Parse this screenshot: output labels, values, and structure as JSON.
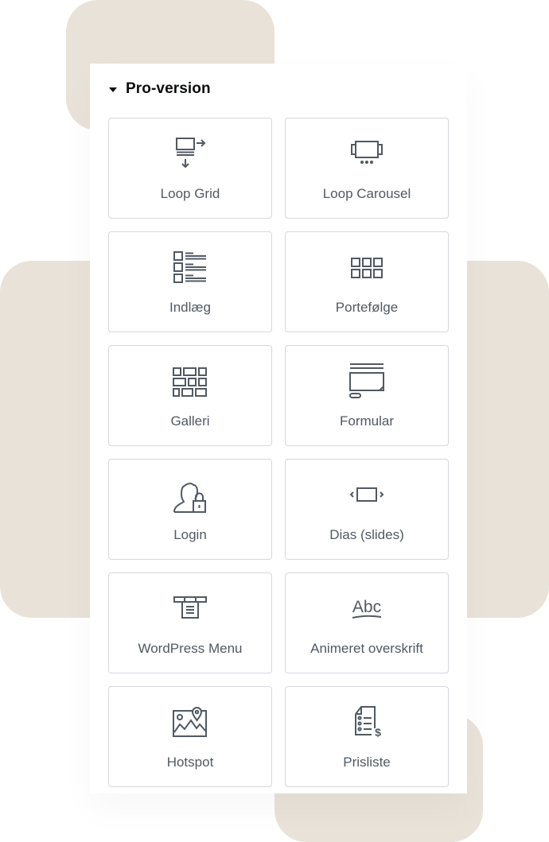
{
  "colors": {
    "background_shape": "#e8e2d8",
    "panel": "#ffffff",
    "tile_border": "#d5d8dc",
    "icon": "#515962",
    "label": "#515962",
    "heading": "#0c0d0e"
  },
  "section": {
    "title": "Pro-version",
    "expanded": true,
    "caret_icon": "caret-down-icon"
  },
  "widgets": [
    {
      "label": "Loop Grid",
      "icon": "loop-grid-icon"
    },
    {
      "label": "Loop Carousel",
      "icon": "loop-carousel-icon"
    },
    {
      "label": "Indlæg",
      "icon": "posts-icon"
    },
    {
      "label": "Portefølge",
      "icon": "portfolio-icon"
    },
    {
      "label": "Galleri",
      "icon": "gallery-icon"
    },
    {
      "label": "Formular",
      "icon": "form-icon"
    },
    {
      "label": "Login",
      "icon": "login-icon"
    },
    {
      "label": "Dias (slides)",
      "icon": "slides-icon"
    },
    {
      "label": "WordPress Menu",
      "icon": "nav-menu-icon"
    },
    {
      "label": "Animeret overskrift",
      "icon": "animated-headline-icon"
    },
    {
      "label": "Hotspot",
      "icon": "hotspot-icon"
    },
    {
      "label": "Prisliste",
      "icon": "price-list-icon"
    }
  ]
}
